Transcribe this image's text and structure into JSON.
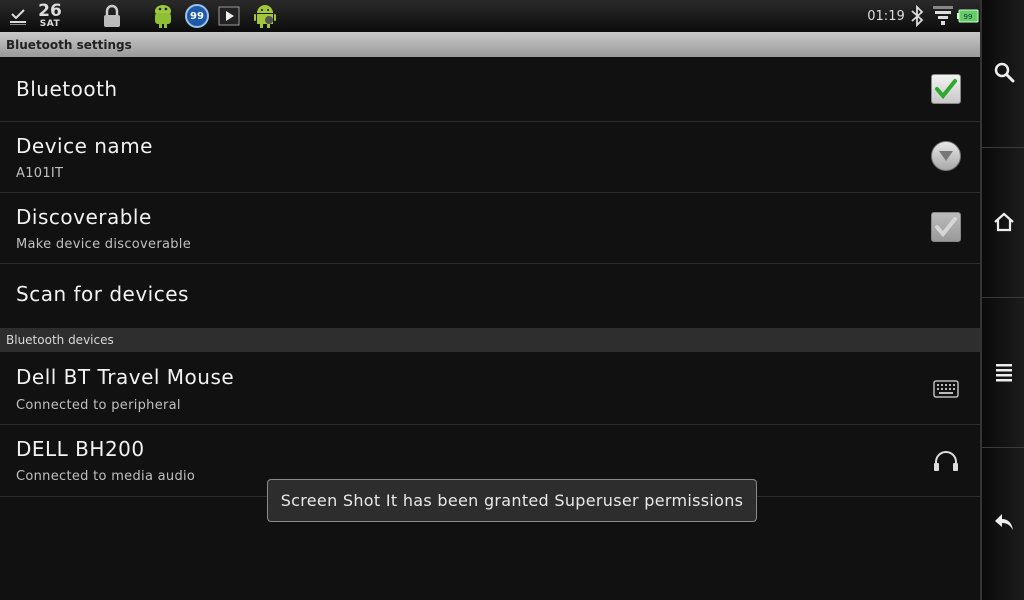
{
  "status_bar": {
    "date_day": "26",
    "date_weekday": "SAT",
    "badge_count": "99",
    "time": "01:19",
    "icons": [
      "download-done-icon",
      "lock-icon",
      "android-app-icon",
      "notification-count-badge",
      "play-store-icon",
      "android-robot-icon",
      "bluetooth-icon",
      "wifi-icon",
      "battery-icon"
    ]
  },
  "settings": {
    "header": "Bluetooth settings",
    "bluetooth": {
      "title": "Bluetooth",
      "checked": true
    },
    "device_name": {
      "title": "Device name",
      "summary": "A101IT"
    },
    "discoverable": {
      "title": "Discoverable",
      "summary": "Make device discoverable",
      "checked": false
    },
    "scan": {
      "title": "Scan for devices"
    }
  },
  "devices": {
    "header": "Bluetooth devices",
    "items": [
      {
        "name": "Dell BT Travel Mouse",
        "status": "Connected to peripheral",
        "icon": "keyboard-icon"
      },
      {
        "name": "DELL BH200",
        "status": "Connected to media audio",
        "icon": "headphones-icon"
      }
    ]
  },
  "toast": {
    "message": "Screen Shot It has been granted Superuser permissions"
  },
  "system_bar": {
    "buttons": [
      "search-icon",
      "home-icon",
      "menu-icon",
      "back-icon"
    ]
  },
  "colors": {
    "background": "#111111",
    "check_green": "#2fa82f",
    "header_gray": "#b0b0b0"
  }
}
